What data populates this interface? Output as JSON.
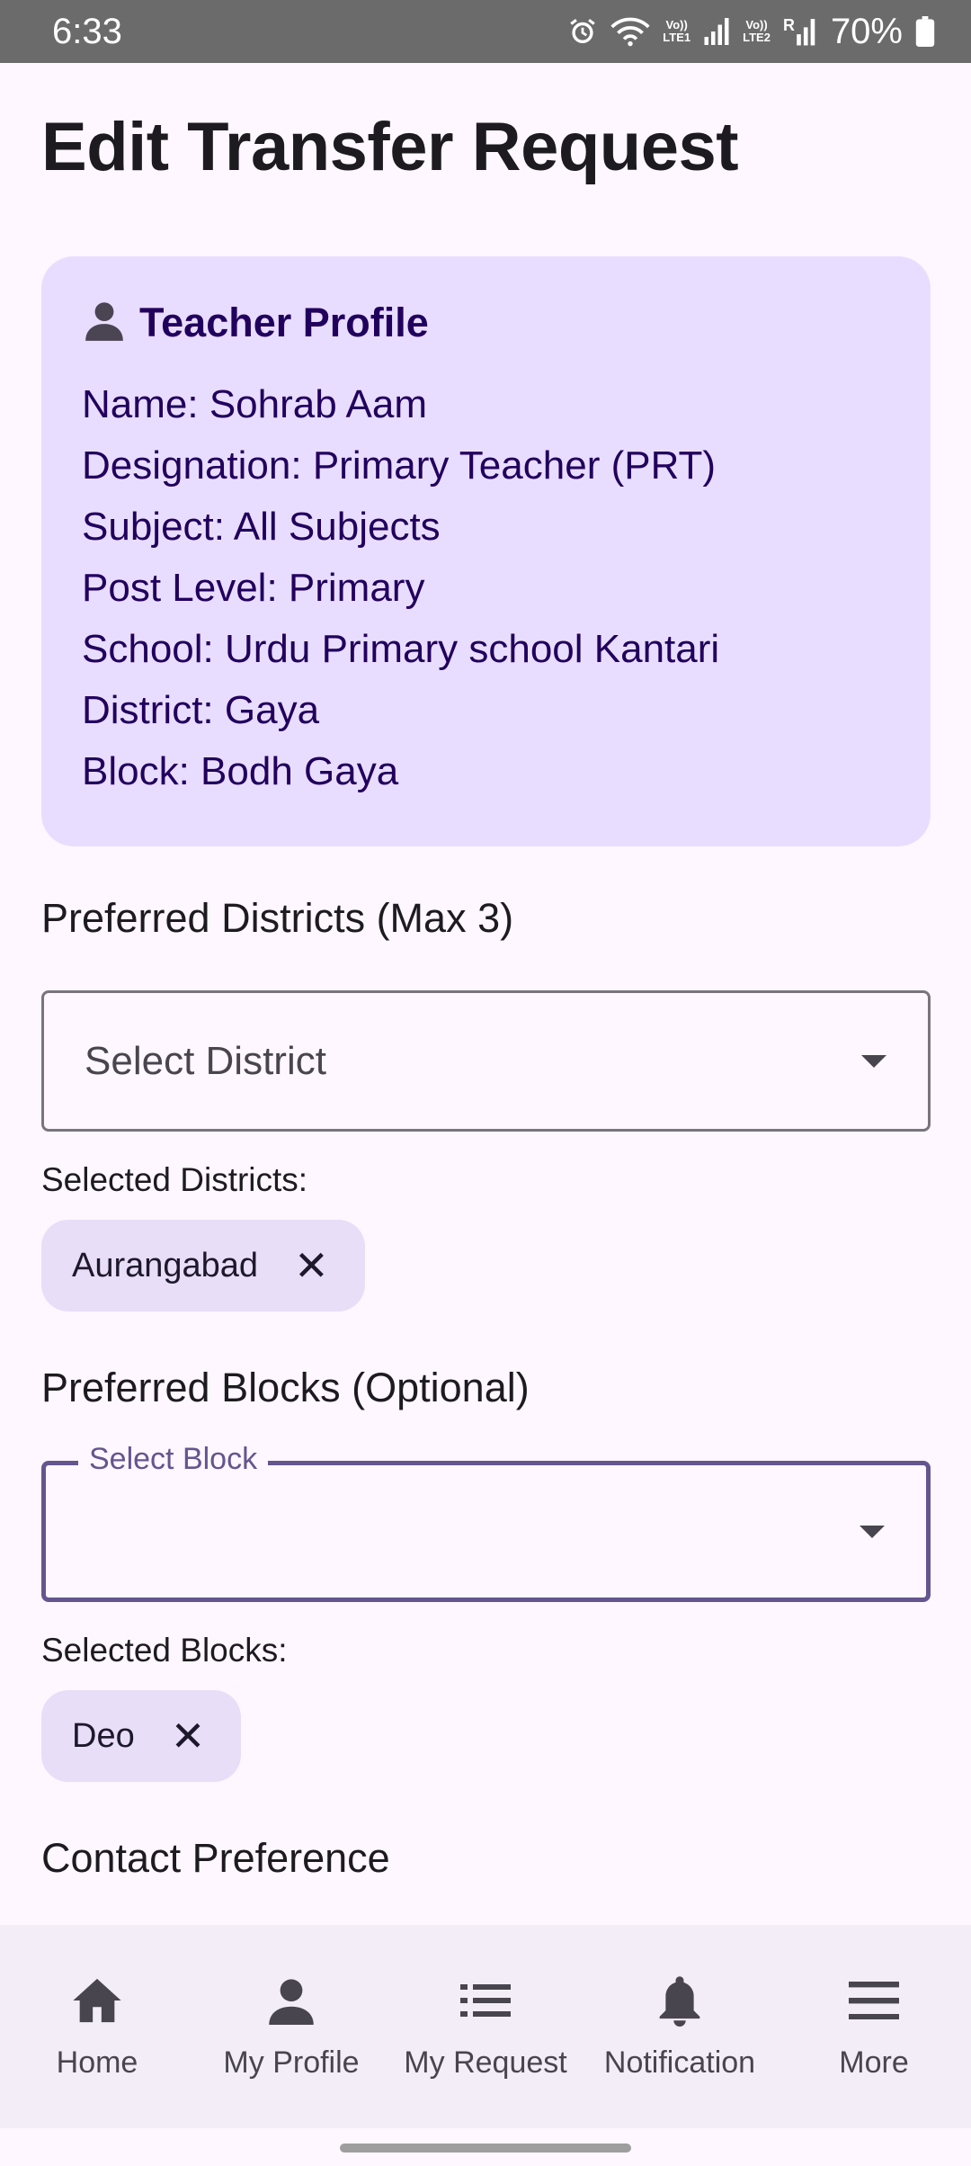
{
  "status_bar": {
    "time": "6:33",
    "battery": "70%",
    "sim1_label": "Vo))\nLTE1",
    "sim2_label": "Vo))\nLTE2",
    "roaming": "R"
  },
  "page": {
    "title": "Edit Transfer Request"
  },
  "profile": {
    "header_icon": "person-icon",
    "header": "Teacher Profile",
    "lines": [
      "Name: Sohrab Aam",
      "Designation: Primary Teacher (PRT)",
      "Subject: All Subjects",
      "Post Level: Primary",
      "School: Urdu Primary school Kantari",
      "District: Gaya",
      "Block: Bodh Gaya"
    ]
  },
  "districts": {
    "heading": "Preferred Districts (Max 3)",
    "dropdown_placeholder": "Select District",
    "selected_label": "Selected Districts:",
    "chips": [
      "Aurangabad"
    ]
  },
  "blocks": {
    "heading": "Preferred Blocks (Optional)",
    "dropdown_label": "Select Block",
    "selected_label": "Selected Blocks:",
    "chips": [
      "Deo"
    ]
  },
  "contact": {
    "heading": "Contact Preference"
  },
  "chip_close_glyph": "✕",
  "bottom_nav": {
    "items": [
      {
        "label": "Home",
        "icon": "home-icon"
      },
      {
        "label": "My Profile",
        "icon": "person-icon"
      },
      {
        "label": "My Request",
        "icon": "list-icon"
      },
      {
        "label": "Notification",
        "icon": "bell-icon"
      },
      {
        "label": "More",
        "icon": "menu-icon"
      }
    ]
  },
  "colors": {
    "background": "#FEF7FF",
    "card": "#E9DDFF",
    "card_text": "#21005D",
    "accent": "#65558F",
    "chip": "#E8DEF8",
    "nav_bg": "#F3EDF7",
    "status_bar": "#6B6B6B"
  }
}
